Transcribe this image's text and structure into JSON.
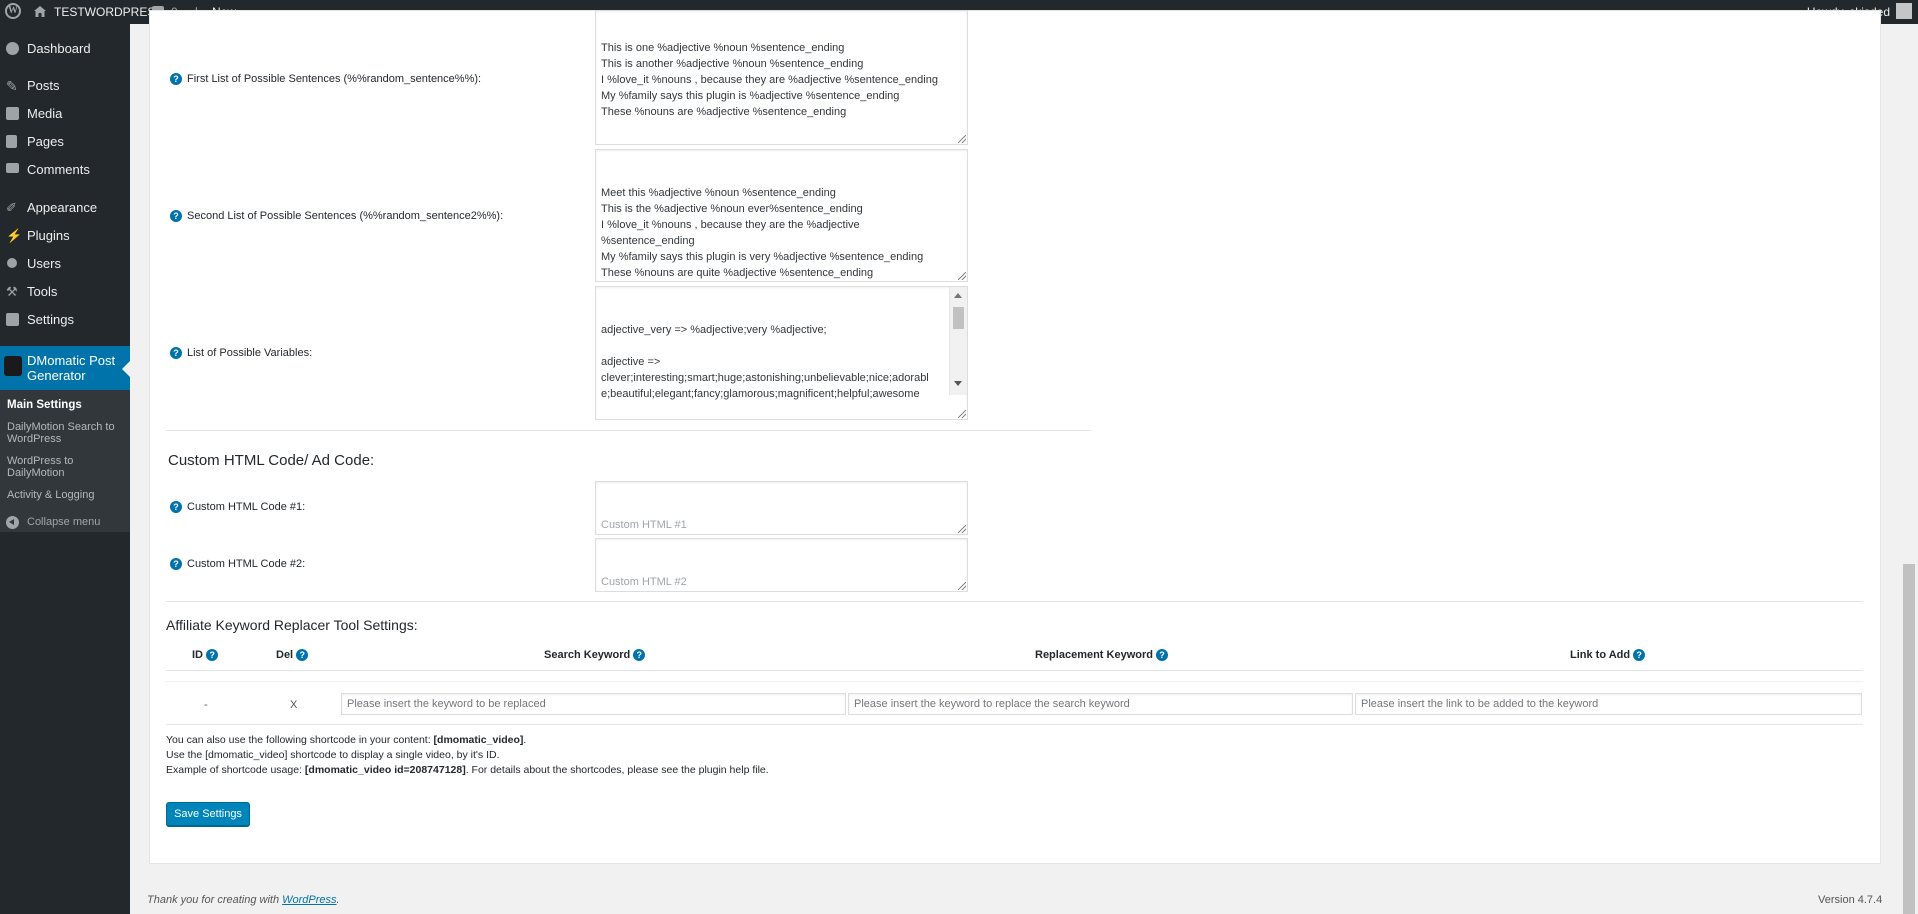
{
  "admin_bar": {
    "site_name": "TESTWORDPRESS",
    "comments_count": "0",
    "new_label": "New",
    "greeting": "Howdy, skisded"
  },
  "sidebar": {
    "items": [
      {
        "label": "Dashboard",
        "icon": "dashboard-icon"
      },
      {
        "label": "Posts",
        "icon": "pin-icon"
      },
      {
        "label": "Media",
        "icon": "media-icon"
      },
      {
        "label": "Pages",
        "icon": "pages-icon"
      },
      {
        "label": "Comments",
        "icon": "comments-icon"
      },
      {
        "label": "Appearance",
        "icon": "brush-icon"
      },
      {
        "label": "Plugins",
        "icon": "plugin-icon"
      },
      {
        "label": "Users",
        "icon": "users-icon"
      },
      {
        "label": "Tools",
        "icon": "wrench-icon"
      },
      {
        "label": "Settings",
        "icon": "settings-icon"
      }
    ],
    "active_label": "DMomatic Post Generator",
    "submenu": [
      "Main Settings",
      "DailyMotion Search to WordPress",
      "WordPress to DailyMotion",
      "Activity & Logging"
    ],
    "collapse_label": "Collapse menu"
  },
  "settings": {
    "first_sentences_label": "First List of Possible Sentences (%%random_sentence%%):",
    "first_sentences_value": "This is one %adjective %noun %sentence_ending\nThis is another %adjective %noun %sentence_ending\nI %love_it %nouns , because they are %adjective %sentence_ending\nMy %family says this plugin is %adjective %sentence_ending\nThese %nouns are %adjective %sentence_ending",
    "second_sentences_label": "Second List of Possible Sentences (%%random_sentence2%%):",
    "second_sentences_value": "Meet this %adjective %noun %sentence_ending\nThis is the %adjective %noun ever%sentence_ending\nI %love_it %nouns , because they are the %adjective\n%sentence_ending\nMy %family says this plugin is very %adjective %sentence_ending\nThese %nouns are quite %adjective %sentence_ending",
    "variables_label": "List of Possible Variables:",
    "variables_value": "adjective_very => %adjective;very %adjective;\n\nadjective =>\nclever;interesting;smart;huge;astonishing;unbelievable;nice;adorabl\ne;beautiful;elegant;fancy;glamorous;magnificent;helpful;awesome\n\nnoun_with_adjective => %noun;%adjective %noun",
    "custom_html_title": "Custom HTML Code/ Ad Code:",
    "custom_html_1_label": "Custom HTML Code #1:",
    "custom_html_1_placeholder": "Custom HTML #1",
    "custom_html_2_label": "Custom HTML Code #2:",
    "custom_html_2_placeholder": "Custom HTML #2"
  },
  "affiliate": {
    "title": "Affiliate Keyword Replacer Tool Settings:",
    "headers": {
      "id": "ID",
      "del": "Del",
      "search": "Search Keyword",
      "replacement": "Replacement Keyword",
      "link": "Link to Add"
    },
    "row": {
      "id": "-",
      "del": "X",
      "search_placeholder": "Please insert the keyword to be replaced",
      "replacement_placeholder": "Please insert the keyword to replace the search keyword",
      "link_placeholder": "Please insert the link to be added to the keyword"
    }
  },
  "notes": {
    "line1_text": "You can also use the following shortcode in your content: ",
    "line1_code": "[dmomatic_video]",
    "line1_end": ".",
    "line2": "Use the [dmomatic_video] shortcode to display a single video, by it's ID.",
    "line3_text": "Example of shortcode usage: ",
    "line3_code": "[dmomatic_video id=208747128]",
    "line3_end": ". For details about the shortcodes, please see the plugin help file."
  },
  "save_label": "Save Settings",
  "footer": {
    "thanks_text": "Thank you for creating with ",
    "wp_link": "WordPress",
    "thanks_end": ".",
    "version": "Version 4.7.4"
  },
  "colors": {
    "admin_bar": "#23282d",
    "menu_active": "#0073aa",
    "button": "#0085ba"
  }
}
